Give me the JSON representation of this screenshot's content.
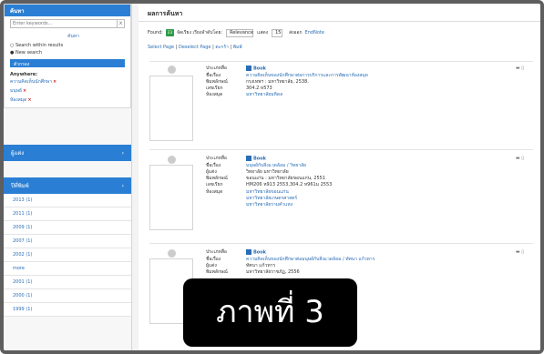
{
  "sidebar": {
    "search_header": "ค้นหา",
    "search_placeholder": "Enter keywords...",
    "search_clear": "x",
    "search_button": "ค้นหา",
    "options": [
      "Search within results",
      "New search"
    ],
    "refine_header": "ตัวกรอง",
    "keywords_title": "Anywhere:",
    "keywords": [
      "ความคิดเห็นนักศึกษา",
      "มนุษย์",
      "ห้องสมุด"
    ],
    "author_header": "ผู้แต่ง",
    "year_header": "ปีที่พิมพ์",
    "years": [
      "2013 (1)",
      "2011 (1)",
      "2009 (1)",
      "2007 (1)",
      "2002 (1)",
      "more",
      "2001 (1)",
      "2000 (1)",
      "1999 (1)"
    ]
  },
  "main": {
    "title": "ผลการค้นหา",
    "found_label": "Found:",
    "found_count": "23",
    "sort_label": "จัดเรียง เรียงลำดับโดย:",
    "sort_value": "Relevance",
    "per_page_label": "แสดง",
    "per_page_value": "15",
    "export_label": "ส่งออก",
    "export_format": "EndNote",
    "toolbar": {
      "select_page": "Select Page",
      "deselect_page": "Deselect Page",
      "basket": "ตะกร้า",
      "print": "พิมพ์"
    }
  },
  "records": [
    {
      "format": "Book",
      "rows": [
        {
          "label": "ประเภทสื่อ",
          "value": "",
          "blue": false
        },
        {
          "label": "ชื่อเรื่อง",
          "value": "ความคิดเห็นของนักศึกษาต่อการบริการและการพัฒนาห้องสมุด",
          "blue": true
        },
        {
          "label": "พิมพลักษณ์",
          "value": "กรุงเทพฯ : มหาวิทยาลัย, 2538.",
          "blue": false
        },
        {
          "label": "เลขเรียก",
          "value": "304.2 ห573",
          "blue": false
        },
        {
          "label": "ห้องสมุด",
          "value": "มหาวิทยาลัยมหิดล",
          "blue": true
        }
      ]
    },
    {
      "format": "Book",
      "rows": [
        {
          "label": "ประเภทสื่อ",
          "value": "",
          "blue": false
        },
        {
          "label": "ชื่อเรื่อง",
          "value": "มนุษย์กับสิ่งแวดล้อม / วิทยาลัย",
          "blue": true
        },
        {
          "label": "ผู้แต่ง",
          "value": "วิทยาลัย มหาวิทยาลัย",
          "blue": false
        },
        {
          "label": "พิมพลักษณ์",
          "value": "ขอนแก่น : มหาวิทยาลัยขอนแก่น, 2551",
          "blue": false
        },
        {
          "label": "เลขเรียก",
          "value": "HM206 ห913 2553,304.2 ห961ม 2553",
          "blue": false
        },
        {
          "label": "ห้องสมุด",
          "value": "มหาวิทยาลัยขอนแก่น",
          "blue": true
        },
        {
          "label": "",
          "value": "มหาวิทยาลัยเกษตรศาสตร์",
          "blue": true
        },
        {
          "label": "",
          "value": "มหาวิทยาลัยรามคำแหง",
          "blue": true
        }
      ]
    },
    {
      "format": "Book",
      "rows": [
        {
          "label": "ประเภทสื่อ",
          "value": "",
          "blue": false
        },
        {
          "label": "ชื่อเรื่อง",
          "value": "ความคิดเห็นของนักศึกษาต่อมนุษย์กับสิ่งแวดล้อม / ทัศนา แก้วทาร",
          "blue": true
        },
        {
          "label": "ผู้แต่ง",
          "value": "ทัศนา แก้วทาร",
          "blue": false
        },
        {
          "label": "พิมพลักษณ์",
          "value": "มหาวิทยาลัยราชภัฏ, 2556",
          "blue": false
        }
      ]
    }
  ],
  "overlay_caption": "ภาพที่ 3"
}
